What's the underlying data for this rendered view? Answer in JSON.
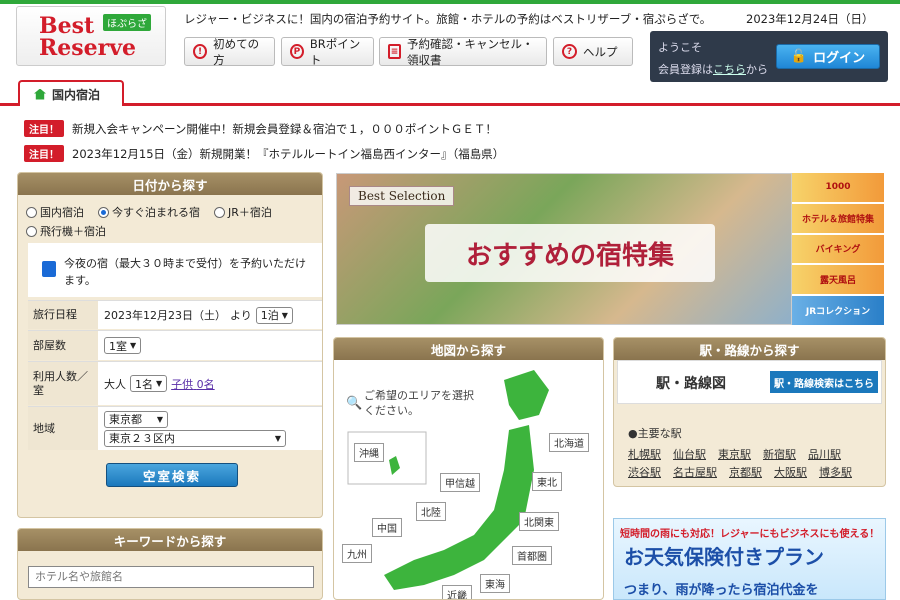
{
  "header": {
    "logo_line1": "Best",
    "logo_line2": "Reserve",
    "logo_tag": "ほぷらざ",
    "tagline": "レジャー・ビジネスに！国内の宿泊予約サイト。旅館・ホテルの予約はベストリザーブ・宿ぷらざで。",
    "date": "2023年12月24日（日）"
  },
  "nav": [
    {
      "label": "初めての方",
      "icon": "question-mark-icon"
    },
    {
      "label": "BRポイント",
      "icon": "p-point-icon"
    },
    {
      "label": "予約確認・キャンセル・領収書",
      "icon": "document-icon"
    },
    {
      "label": "ヘルプ",
      "icon": "help-icon"
    }
  ],
  "login": {
    "welcome": "ようこそ",
    "register_prefix": "会員登録は",
    "register_link": "こちら",
    "register_suffix": "から",
    "button": "ログイン"
  },
  "tab": {
    "label": "国内宿泊"
  },
  "news": [
    {
      "badge": "注目！",
      "text": "新規入会キャンペーン開催中！新規会員登録＆宿泊で１，０００ポイントＧＥＴ！"
    },
    {
      "badge": "注目！",
      "text": "2023年12月15日（金）新規開業！『ホテルルートイン福島西インター』（福島県）"
    }
  ],
  "date_search": {
    "title": "日付から探す",
    "radios": [
      {
        "label": "国内宿泊",
        "checked": false
      },
      {
        "label": "今すぐ泊まれる宿",
        "checked": true
      },
      {
        "label": "JR＋宿泊",
        "checked": false
      },
      {
        "label": "飛行機＋宿泊",
        "checked": false
      }
    ],
    "tonight_text": "今夜の宿（最大３０時まで受付）を予約いただけます。",
    "itinerary_label": "旅行日程",
    "itinerary_date": "2023年12月23日（土）",
    "itinerary_from": "より",
    "nights": "1泊",
    "rooms_label": "部屋数",
    "rooms": "1室",
    "guests_label": "利用人数／室",
    "adult_label": "大人",
    "adults": "1名",
    "child_label": "子供",
    "children": "0名",
    "area_label": "地域",
    "area_pref": "東京都",
    "area_city": "東京２３区内",
    "search_button": "空室検索"
  },
  "keyword": {
    "title": "キーワードから探す",
    "placeholder": "ホテル名や旅館名"
  },
  "banner": {
    "badge": "Best Selection",
    "title": "おすすめの宿特集",
    "side": [
      "1000",
      "ホテル＆旅館特集",
      "バイキング",
      "露天風呂",
      "JRコレクション"
    ]
  },
  "map": {
    "title": "地図から探す",
    "hint": "ご希望のエリアを選択ください。",
    "regions": [
      "沖縄",
      "北海道",
      "東北",
      "甲信越",
      "北陸",
      "北関東",
      "中国",
      "九州",
      "首都圏",
      "近畿",
      "東海"
    ]
  },
  "station": {
    "title": "駅・路線から探す",
    "map_title": "駅・路線図",
    "map_button": "駅・路線検索はこちら",
    "main_heading": "●主要な駅",
    "stations": [
      "札幌駅",
      "仙台駅",
      "東京駅",
      "新宿駅",
      "品川駅",
      "渋谷駅",
      "名古屋駅",
      "京都駅",
      "大阪駅",
      "博多駅"
    ]
  },
  "promo": {
    "line1": "短時間の雨にも対応！レジャーにもビジネスにも使える！",
    "line2": "お天気保険付きプラン",
    "line3": "つまり、雨が降ったら宿泊代金を"
  }
}
